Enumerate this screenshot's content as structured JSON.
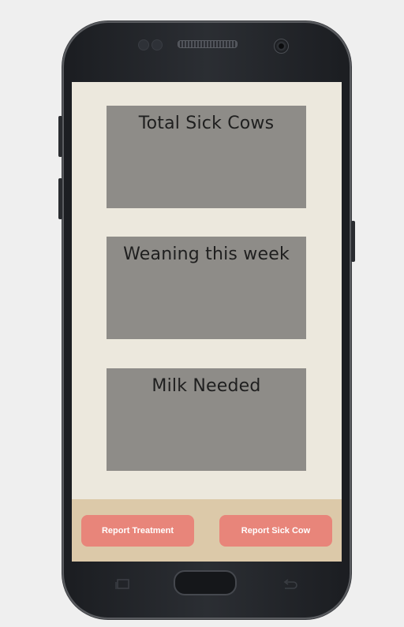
{
  "cards": [
    {
      "title": "Total Sick Cows"
    },
    {
      "title": "Weaning this week"
    },
    {
      "title": "Milk Needed"
    }
  ],
  "actions": {
    "report_treatment": "Report Treatment",
    "report_sick_cow": "Report Sick Cow"
  },
  "colors": {
    "screen_background": "#ece8dd",
    "card": "#8e8c88",
    "bottom_bar": "#dcc9a9",
    "button": "#e8857a",
    "phone_body": "#1f2125"
  }
}
